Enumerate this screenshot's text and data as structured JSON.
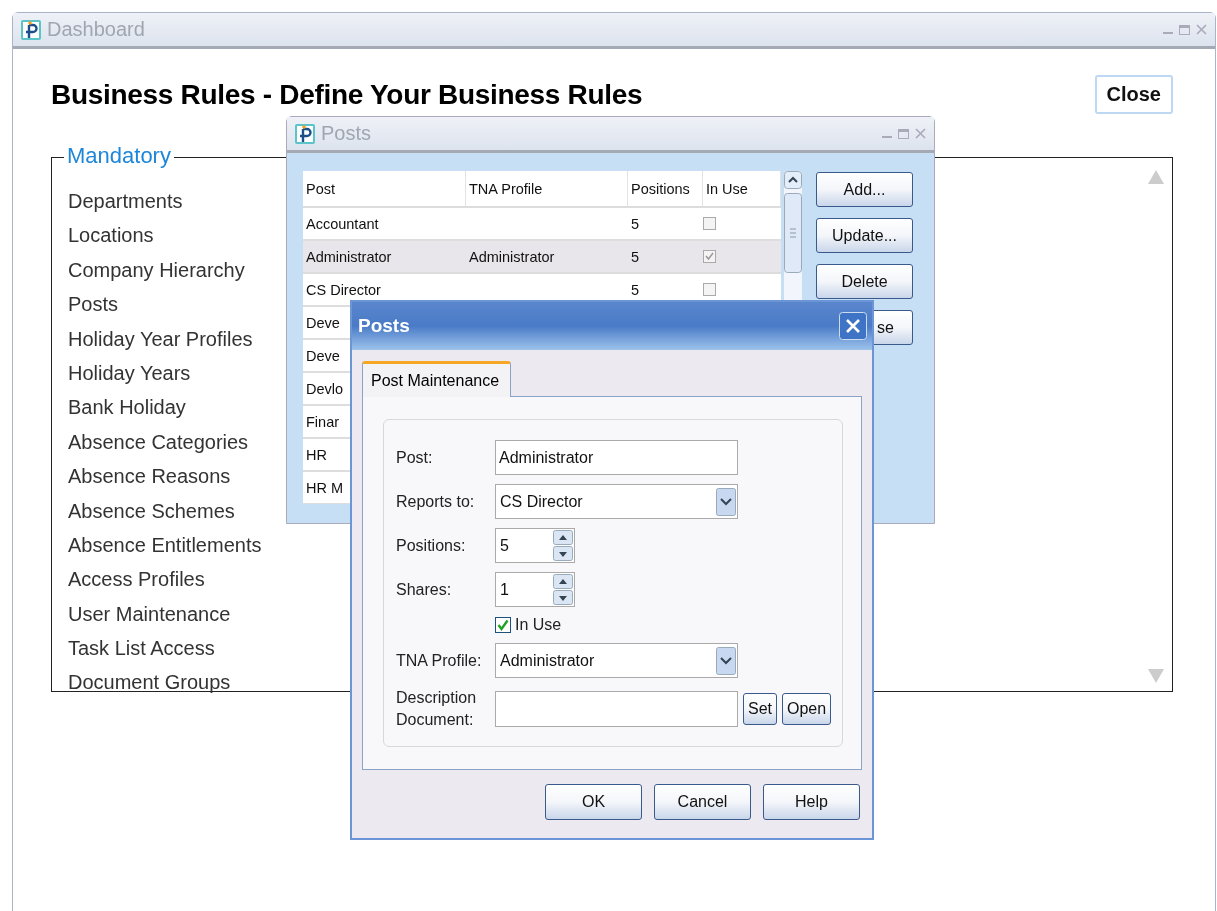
{
  "dashboard": {
    "title": "Dashboard",
    "heading": "Business Rules - Define Your Business Rules",
    "close_button": "Close",
    "mandatory": {
      "legend": "Mandatory",
      "items": [
        "Departments",
        "Locations",
        "Company Hierarchy",
        "Posts",
        "Holiday Year Profiles",
        "Holiday Years",
        "Bank Holiday",
        "Absence Categories",
        "Absence Reasons",
        "Absence Schemes",
        "Absence Entitlements",
        "Access Profiles",
        "User Maintenance",
        "Task List Access",
        "Document Groups"
      ]
    }
  },
  "posts_window": {
    "title": "Posts",
    "table": {
      "columns": [
        "Post",
        "TNA Profile",
        "Positions",
        "In Use"
      ],
      "rows": [
        {
          "post": "Accountant",
          "positions": "5",
          "in_use": false,
          "selected": false
        },
        {
          "post": "Administrator",
          "tna_profile": "Administrator",
          "positions": "5",
          "in_use": true,
          "selected": true
        },
        {
          "post": "CS Director",
          "positions": "5",
          "in_use": false,
          "selected": false
        },
        {
          "post": "Deve",
          "selected": false
        },
        {
          "post": "Deve",
          "selected": false
        },
        {
          "post": "Devlo",
          "selected": false
        },
        {
          "post": "Finar",
          "selected": false
        },
        {
          "post": "HR",
          "selected": false
        },
        {
          "post": "HR M",
          "selected": false
        }
      ]
    },
    "buttons": [
      "Add...",
      "Update...",
      "Delete",
      "se"
    ]
  },
  "dialog": {
    "title": "Posts",
    "tabs": [
      {
        "label": "Post Maintenance",
        "selected": true
      }
    ],
    "fields": [
      {
        "kind": "text",
        "label": "Post:",
        "value": "Administrator"
      },
      {
        "kind": "select",
        "label": "Reports to:",
        "value": "CS Director"
      },
      {
        "kind": "spin",
        "label": "Positions:",
        "value": "5"
      },
      {
        "kind": "spin",
        "label": "Shares:",
        "value": "1"
      },
      {
        "kind": "checkbox",
        "label": "In Use",
        "checked": true
      },
      {
        "kind": "select",
        "label": "TNA Profile:",
        "value": "Administrator"
      },
      {
        "kind": "document",
        "label": "Description Document:",
        "buttons": [
          "Set",
          "Open"
        ]
      }
    ],
    "buttons": [
      "OK",
      "Cancel",
      "Help"
    ]
  }
}
